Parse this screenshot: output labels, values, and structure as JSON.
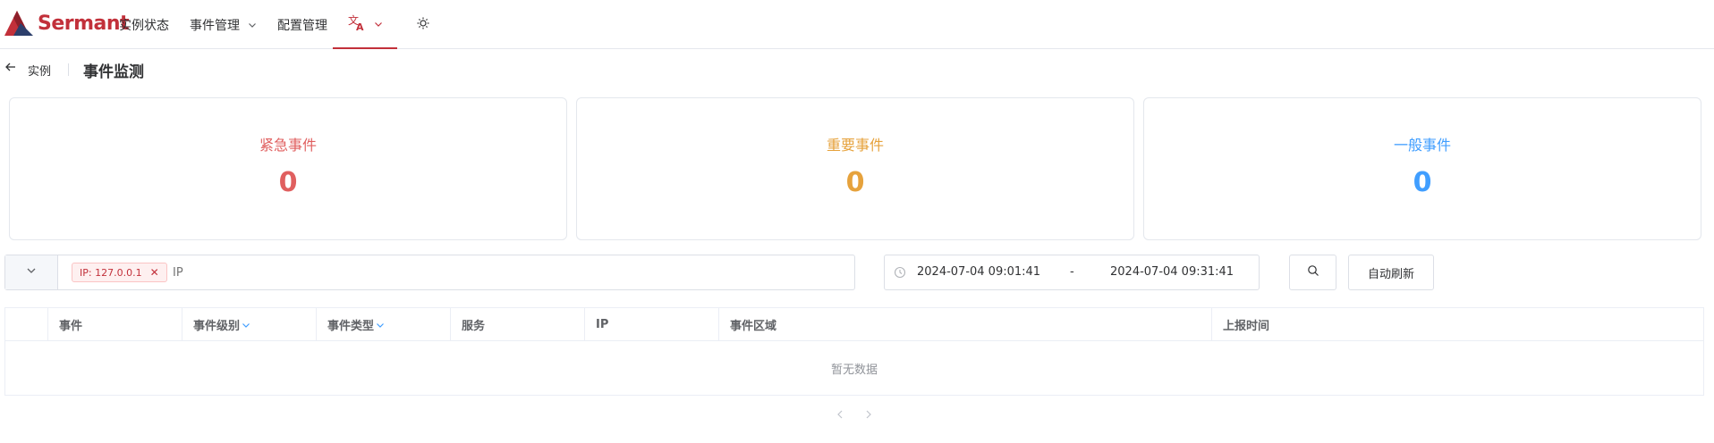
{
  "header": {
    "brand": "Sermant",
    "nav": [
      {
        "label": "实例状态"
      },
      {
        "label": "事件管理"
      },
      {
        "label": "配置管理"
      }
    ],
    "translate_icon": "translate-icon",
    "theme_icon": "sun-icon"
  },
  "breadcrumb": {
    "back_label": "实例",
    "title": "事件监测"
  },
  "cards": [
    {
      "label": "紧急事件",
      "value": "0",
      "color": "#e05f5f"
    },
    {
      "label": "重要事件",
      "value": "0",
      "color": "#e6a23c"
    },
    {
      "label": "一般事件",
      "value": "0",
      "color": "#409eff"
    }
  ],
  "filter": {
    "tag": "IP: 127.0.0.1",
    "placeholder": "IP"
  },
  "date_range": {
    "start": "2024-07-04 09:01:41",
    "separator": "-",
    "end": "2024-07-04 09:31:41"
  },
  "buttons": {
    "auto_refresh": "自动刷新"
  },
  "table": {
    "columns": [
      "事件",
      "事件级别",
      "事件类型",
      "服务",
      "IP",
      "事件区域",
      "上报时间"
    ],
    "empty_text": "暂无数据"
  }
}
